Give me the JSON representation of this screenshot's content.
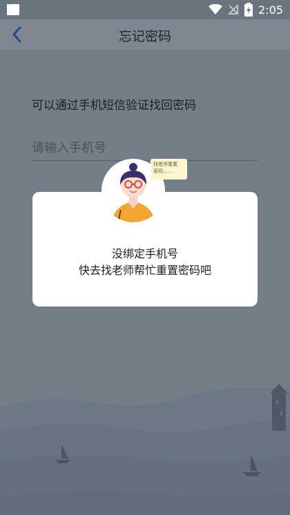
{
  "status_bar": {
    "time": "2:05",
    "icons": [
      "wifi-icon",
      "no-signal-icon",
      "battery-charging-icon"
    ]
  },
  "nav": {
    "title": "忘记密码",
    "back_icon": "chevron-left-icon"
  },
  "form": {
    "hint": "可以通过手机短信验证找回密码",
    "phone_placeholder": "请输入手机号"
  },
  "dialog": {
    "line1": "没绑定手机号",
    "line2": "快去找老师帮忙重置密码吧",
    "bubble_line1": "找老师重置",
    "bubble_line2": "密码……"
  },
  "colors": {
    "overlay_bg": "#737e89",
    "dialog_bg": "#ffffff",
    "shirt": "#f2a531",
    "hair": "#3b2f6b",
    "bubble": "#fff6cf"
  }
}
